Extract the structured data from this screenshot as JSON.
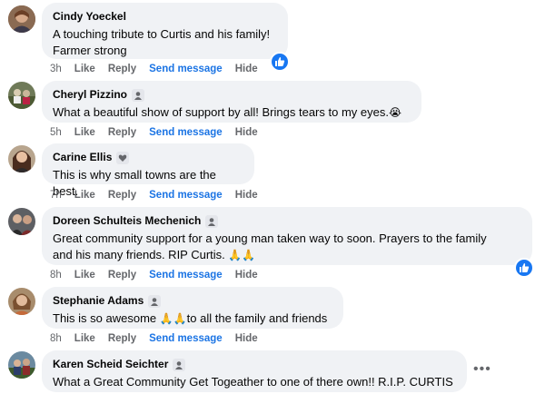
{
  "actions": {
    "like": "Like",
    "reply": "Reply",
    "send_message": "Send message",
    "hide": "Hide"
  },
  "comments": [
    {
      "name": "Cindy Yoeckel",
      "badge": "",
      "lines": [
        "A touching tribute to Curtis and his family!",
        "Farmer strong"
      ],
      "time": "3h",
      "liked": true
    },
    {
      "name": "Cheryl Pizzino",
      "badge": "profile-badge-icon",
      "lines": [
        "What a beautiful show of support by all! Brings tears to my eyes."
      ],
      "emoji": "😭",
      "time": "5h",
      "liked": false
    },
    {
      "name": "Carine Ellis",
      "badge": "heart-badge-icon",
      "lines": [
        "This is why small towns are the best."
      ],
      "time": "7h",
      "liked": false
    },
    {
      "name": "Doreen Schulteis Mechenich",
      "badge": "profile-badge-icon",
      "lines": [
        "Great community support for a young man taken way to soon. Prayers to the family",
        "and his many friends. RIP Curtis."
      ],
      "emoji": "🙏🙏",
      "time": "8h",
      "liked": true
    },
    {
      "name": "Stephanie Adams",
      "badge": "profile-badge-icon",
      "lines_parts": [
        "This is so awesome ",
        "🙏🙏",
        "to all the family and friends"
      ],
      "time": "8h",
      "liked": false
    },
    {
      "name": "Karen Scheid Seichter",
      "badge": "profile-badge-icon",
      "lines": [
        "What a Great Community Get Togeather to one of there own!! R.I.P. CURTIS"
      ],
      "time": "",
      "liked": false
    }
  ],
  "colors": {
    "bubble": "#f0f2f5",
    "link_blue": "#1b74e4",
    "like_blue": "#1877f2",
    "meta_gray": "#65676b"
  }
}
